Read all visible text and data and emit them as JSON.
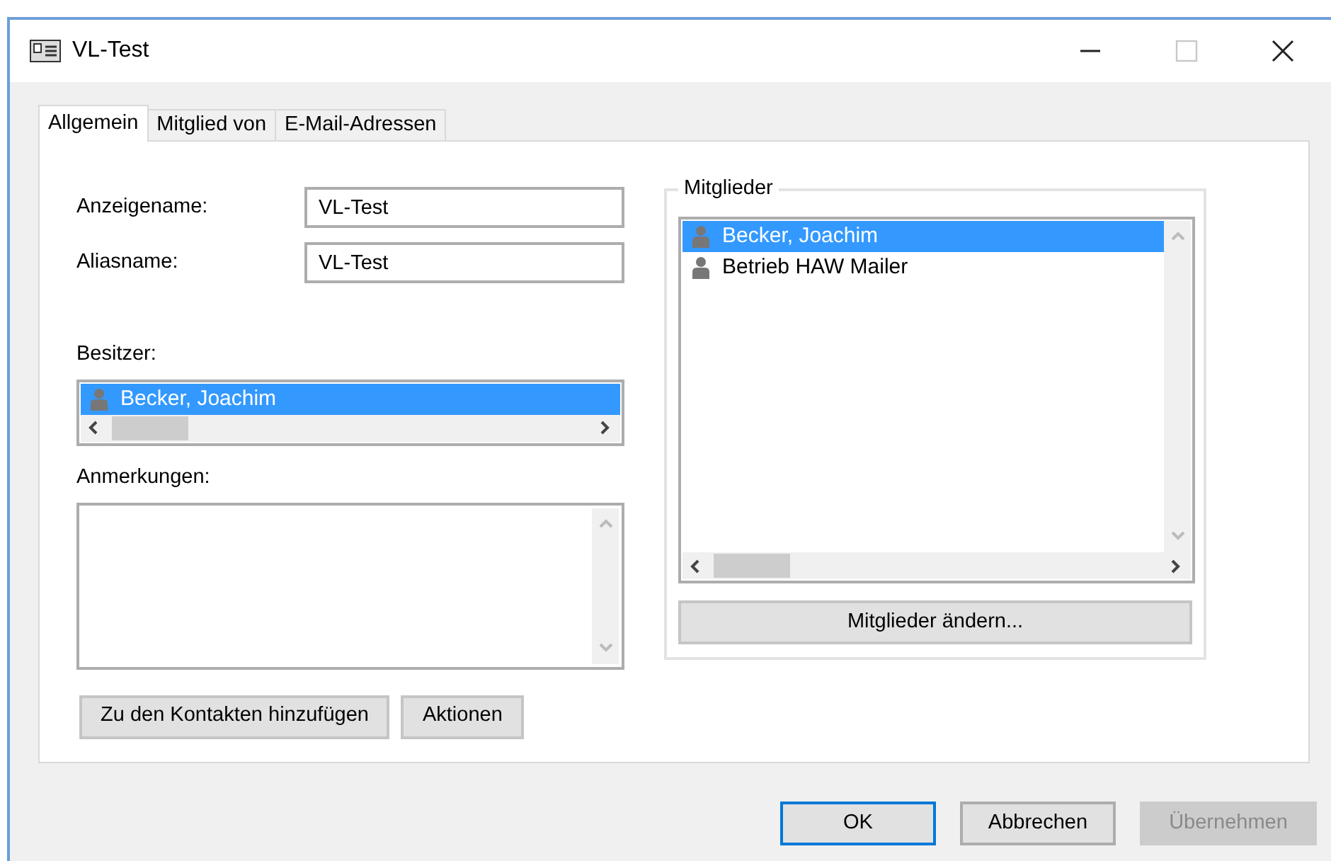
{
  "window": {
    "title": "VL-Test",
    "controls": [
      {
        "kind": "minimize",
        "disabled": false
      },
      {
        "kind": "maximize",
        "disabled": true
      },
      {
        "kind": "close",
        "disabled": false
      }
    ]
  },
  "tabs": [
    {
      "label": "Allgemein",
      "selected": true
    },
    {
      "label": "Mitglied von",
      "selected": false
    },
    {
      "label": "E-Mail-Adressen",
      "selected": false
    }
  ],
  "fields": [
    {
      "label": "Anzeigename:",
      "value": "VL-Test"
    },
    {
      "label": "Aliasname:",
      "value": "VL-Test"
    }
  ],
  "owner": {
    "label": "Besitzer:",
    "items": [
      {
        "name": "Becker, Joachim",
        "selected": true
      }
    ]
  },
  "notes": {
    "label": "Anmerkungen:"
  },
  "left_buttons": [
    "Zu den Kontakten hinzufügen",
    "Aktionen"
  ],
  "members": {
    "title": "Mitglieder",
    "items": [
      {
        "name": "Becker, Joachim",
        "selected": true
      },
      {
        "name": "Betrieb HAW Mailer",
        "selected": false
      }
    ],
    "button": "Mitglieder ändern..."
  },
  "dialog_buttons": [
    {
      "label": "OK",
      "default": true,
      "disabled": false
    },
    {
      "label": "Abbrechen",
      "default": false,
      "disabled": false
    },
    {
      "label": "Übernehmen",
      "default": false,
      "disabled": true
    }
  ]
}
